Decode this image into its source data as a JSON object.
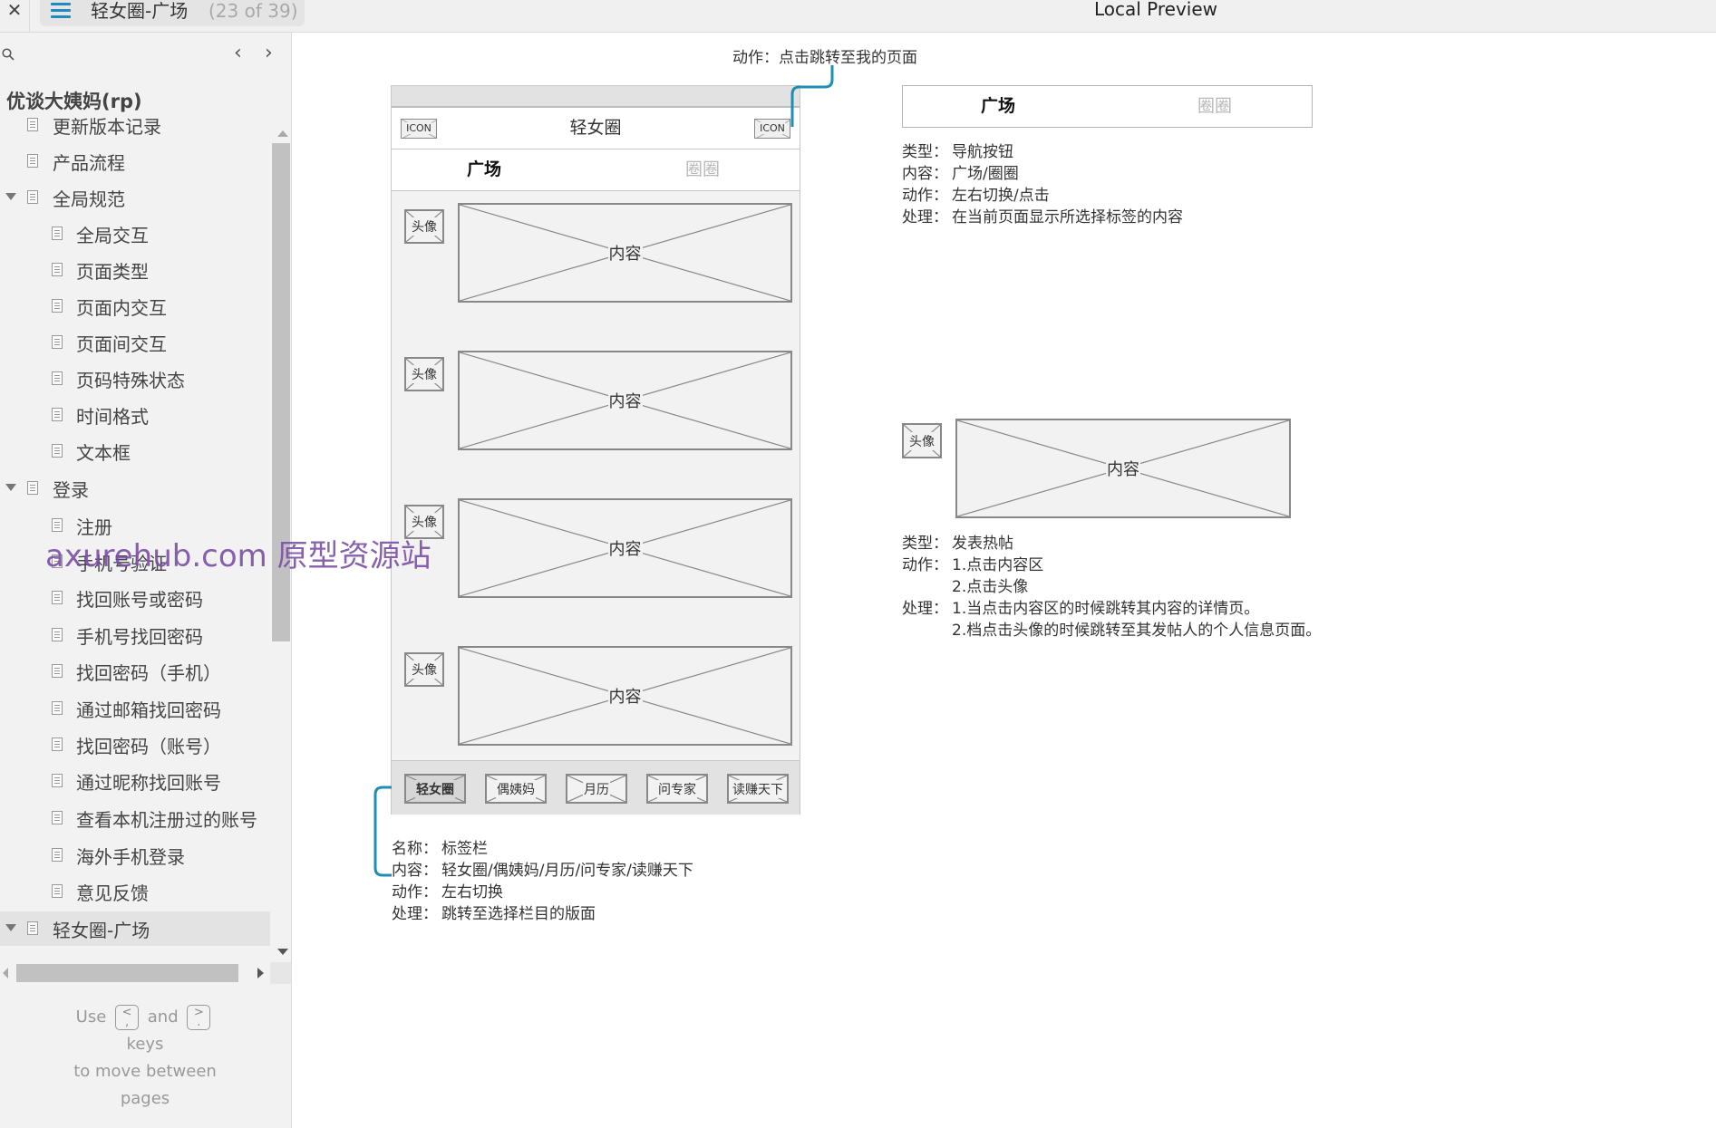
{
  "header": {
    "close_icon": "close-icon",
    "menu_icon": "hamburger-menu-icon",
    "page_title": "轻女圈-广场",
    "page_count": "(23 of 39)",
    "window_title": "Local Preview"
  },
  "sidebar": {
    "search_icon": "search-icon",
    "prev_icon": "‹",
    "next_icon": "›",
    "project_title": "优谈大姨妈(rp)",
    "items": [
      {
        "label": "更新版本记录",
        "level": 0,
        "expanded": null
      },
      {
        "label": "产品流程",
        "level": 0,
        "expanded": null
      },
      {
        "label": "全局规范",
        "level": 0,
        "expanded": true
      },
      {
        "label": "全局交互",
        "level": 1
      },
      {
        "label": "页面类型",
        "level": 1
      },
      {
        "label": "页面内交互",
        "level": 1
      },
      {
        "label": "页面间交互",
        "level": 1
      },
      {
        "label": "页码特殊状态",
        "level": 1
      },
      {
        "label": "时间格式",
        "level": 1
      },
      {
        "label": "文本框",
        "level": 1
      },
      {
        "label": "登录",
        "level": 0,
        "expanded": true
      },
      {
        "label": "注册",
        "level": 1
      },
      {
        "label": "手机号验证",
        "level": 1
      },
      {
        "label": "找回账号或密码",
        "level": 1
      },
      {
        "label": "手机号找回密码",
        "level": 1
      },
      {
        "label": "找回密码（手机）",
        "level": 1
      },
      {
        "label": "通过邮箱找回密码",
        "level": 1
      },
      {
        "label": "找回密码（账号）",
        "level": 1
      },
      {
        "label": "通过昵称找回账号",
        "level": 1
      },
      {
        "label": "查看本机注册过的账号",
        "level": 1
      },
      {
        "label": "海外手机登录",
        "level": 1
      },
      {
        "label": "意见反馈",
        "level": 1
      },
      {
        "label": "轻女圈-广场",
        "level": 0,
        "expanded": true,
        "selected": true
      }
    ],
    "help": {
      "use": "Use",
      "key_prev_top": "<",
      "key_prev_bottom": ",",
      "and": "and",
      "key_next_top": ">",
      "key_next_bottom": ".",
      "keys": "keys",
      "line2": "to move between",
      "line3": "pages"
    }
  },
  "watermark": "axurehub.com 原型资源站",
  "canvas": {
    "top_note": "动作：点击跳转至我的页面",
    "phone": {
      "nav_left_icon": "ICON",
      "nav_title": "轻女圈",
      "nav_right_icon": "ICON",
      "tabs": [
        {
          "label": "广场",
          "active": true
        },
        {
          "label": "圈圈",
          "active": false
        }
      ],
      "posts": [
        {
          "avatar": "头像",
          "content": "内容"
        },
        {
          "avatar": "头像",
          "content": "内容"
        },
        {
          "avatar": "头像",
          "content": "内容"
        },
        {
          "avatar": "头像",
          "content": "内容"
        }
      ],
      "tabbar": [
        {
          "label": "轻女圈",
          "active": true
        },
        {
          "label": "偶姨妈",
          "active": false
        },
        {
          "label": "月历",
          "active": false
        },
        {
          "label": "问专家",
          "active": false
        },
        {
          "label": "读赚天下",
          "active": false
        }
      ]
    },
    "tabbar_note": {
      "rows": [
        {
          "k": "名称：",
          "v": "标签栏"
        },
        {
          "k": "内容：",
          "v": "轻女圈/偶姨妈/月历/问专家/读赚天下"
        },
        {
          "k": "动作：",
          "v": "左右切换"
        },
        {
          "k": "处理：",
          "v": "跳转至选择栏目的版面"
        }
      ]
    },
    "right_tabs": {
      "tabs": [
        {
          "label": "广场",
          "active": true
        },
        {
          "label": "圈圈",
          "active": false
        }
      ],
      "rows": [
        {
          "k": "类型：",
          "v": "导航按钮"
        },
        {
          "k": "内容：",
          "v": "广场/圈圈"
        },
        {
          "k": "动作：",
          "v": "左右切换/点击"
        },
        {
          "k": "处理：",
          "v": "在当前页面显示所选择标签的内容"
        }
      ]
    },
    "right_post": {
      "avatar": "头像",
      "content": "内容",
      "rows": [
        {
          "k": "类型：",
          "v": "发表热帖"
        },
        {
          "k": "动作：",
          "v": "1.点击内容区"
        },
        {
          "k": "",
          "v": "2.点击头像"
        },
        {
          "k": "处理：",
          "v": "1.当点击内容区的时候跳转其内容的详情页。"
        },
        {
          "k": "",
          "v": "2.档点击头像的时候跳转至其发帖人的个人信息页面。"
        }
      ]
    },
    "connector_color": "#1f8fb0"
  }
}
